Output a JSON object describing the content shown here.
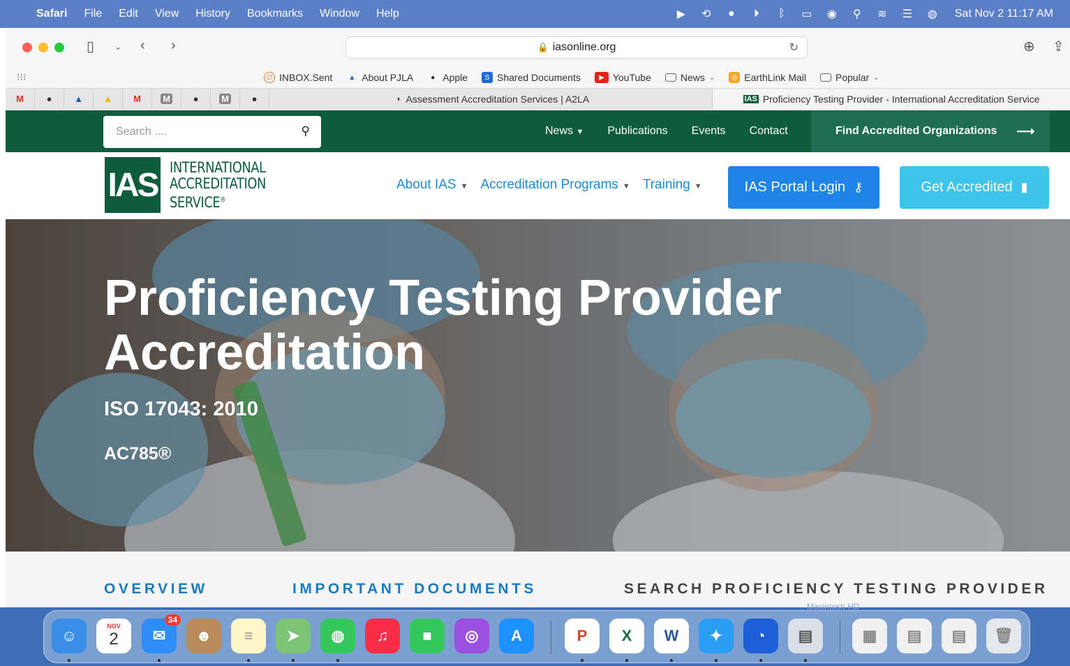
{
  "menubar": {
    "apple_icon": "apple-icon",
    "items": [
      "Safari",
      "File",
      "Edit",
      "View",
      "History",
      "Bookmarks",
      "Window",
      "Help"
    ],
    "clock": "Sat Nov 2  11:17 AM"
  },
  "browser": {
    "url": "iasonline.org",
    "favorites": [
      {
        "label": "INBOX.Sent",
        "icon": "inbox-icon"
      },
      {
        "label": "About PJLA",
        "icon": "pjla-icon"
      },
      {
        "label": "Apple",
        "icon": "apple-icon"
      },
      {
        "label": "Shared Documents",
        "icon": "sharepoint-icon"
      },
      {
        "label": "YouTube",
        "icon": "youtube-icon"
      },
      {
        "label": "News",
        "icon": "folder-icon",
        "dropdown": true
      },
      {
        "label": "EarthLink Mail",
        "icon": "earthlink-icon"
      },
      {
        "label": "Popular",
        "icon": "folder-icon",
        "dropdown": true
      }
    ],
    "pinned_tabs": [
      "M",
      "",
      "",
      "",
      "M",
      "M",
      "",
      "M",
      ""
    ],
    "tabs": [
      {
        "title": "Assessment Accreditation Services | A2LA",
        "active": false
      },
      {
        "title": "Proficiency Testing Provider - International Accreditation Service",
        "favicon": "IAS",
        "active": true
      }
    ]
  },
  "site": {
    "search_placeholder": "Search ....",
    "topnav": [
      "News",
      "Publications",
      "Events",
      "Contact"
    ],
    "find_button": "Find Accredited Organizations",
    "logo": {
      "mark": "IAS",
      "line1": "INTERNATIONAL",
      "line2": "ACCREDITATION",
      "line3": "SERVICE",
      "reg": "®"
    },
    "mainnav": [
      "About IAS",
      "Accreditation Programs",
      "Training"
    ],
    "portal_button": "IAS Portal Login",
    "accredited_button": "Get Accredited",
    "hero": {
      "title_line1": "Proficiency Testing Provider",
      "title_line2": "Accreditation",
      "sub1": "ISO 17043: 2010",
      "sub2": "AC785®"
    },
    "sections": [
      "OVERVIEW",
      "IMPORTANT DOCUMENTS",
      "SEARCH PROFICIENCY TESTING PROVIDER"
    ]
  },
  "dock": {
    "calendar_month": "NOV",
    "calendar_day": "2",
    "mail_badge": "34",
    "ghost_text": "Macintosh HD"
  },
  "colors": {
    "site_green": "#0e5c3c",
    "link_blue": "#1a8ccf",
    "portal_blue": "#1e84e6",
    "accredited_cyan": "#3ec3ea",
    "menubar": "#5b7fc6"
  }
}
